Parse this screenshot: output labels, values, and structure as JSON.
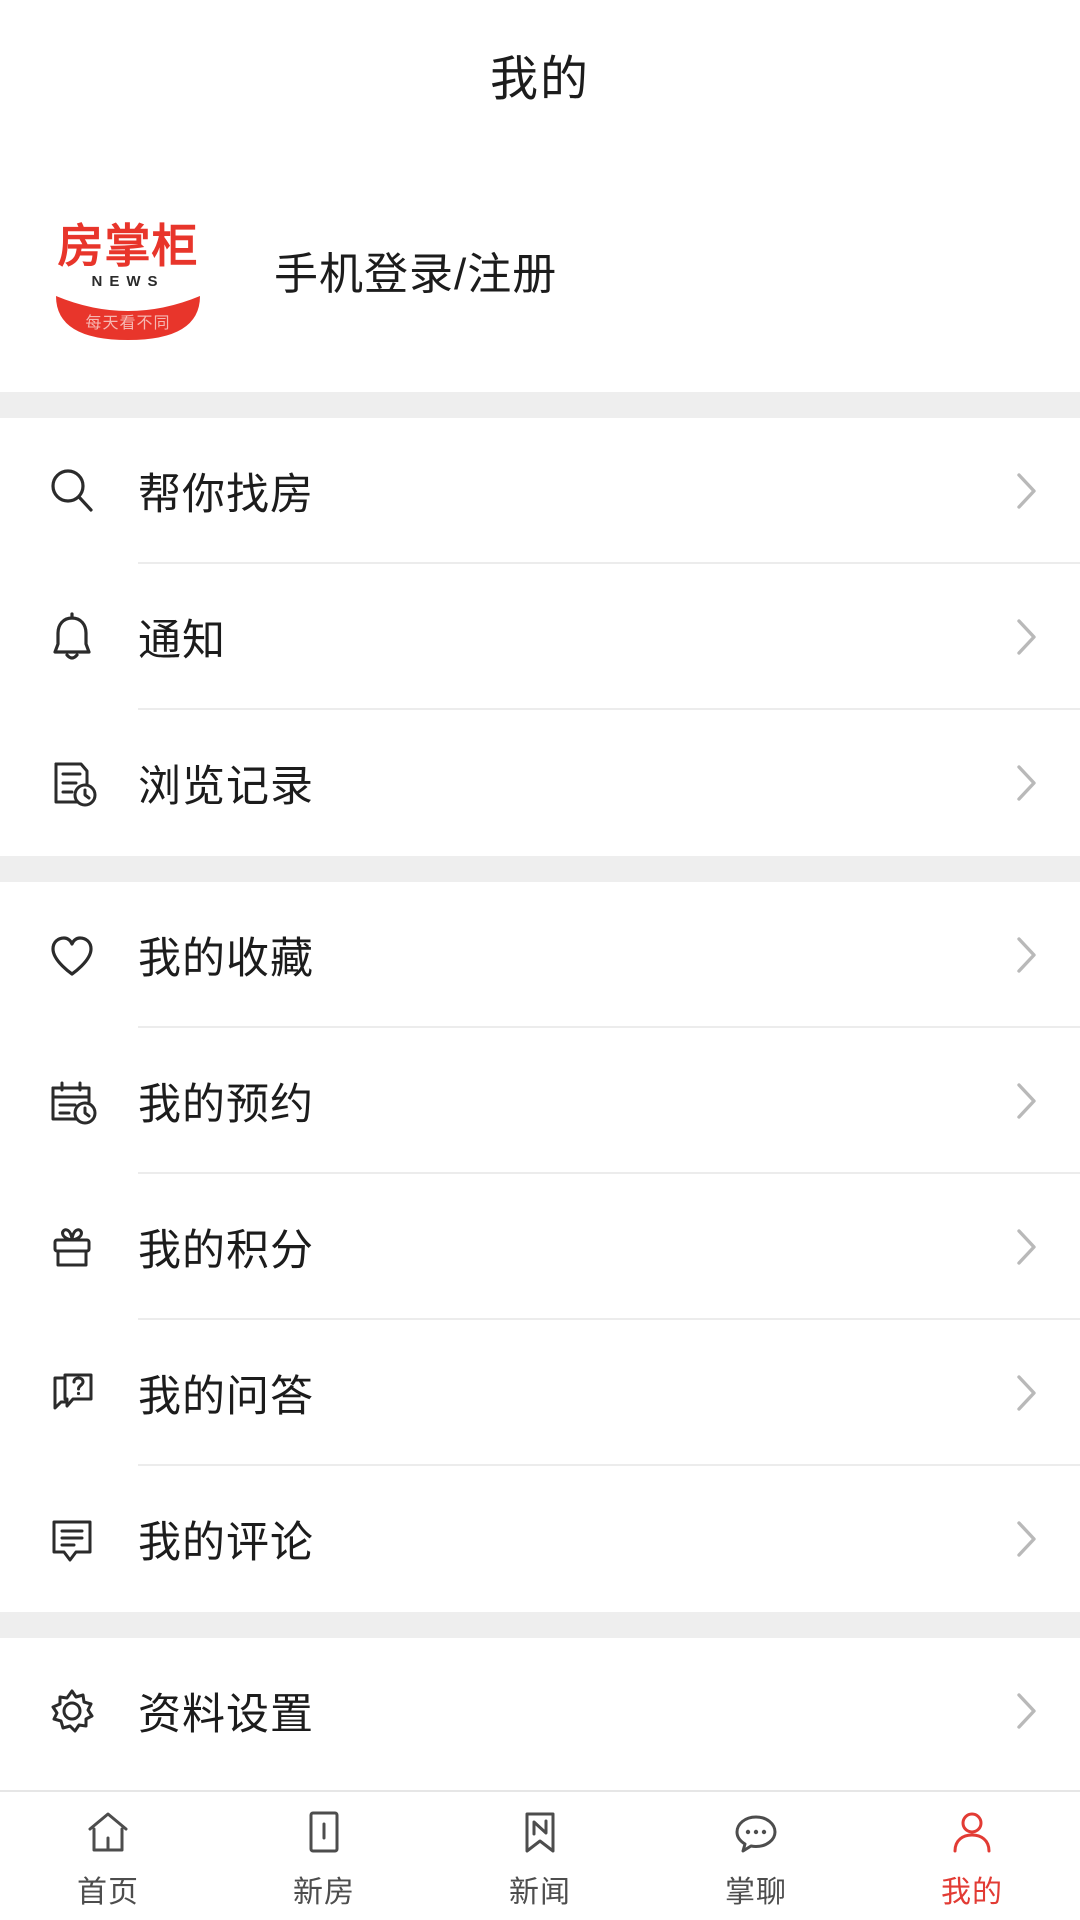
{
  "header": {
    "title": "我的"
  },
  "profile": {
    "logo": {
      "name": "fangzhanggui-news-logo",
      "brand_text": "房掌柜",
      "sub_text": "N E W S",
      "tagline": "每天看不同",
      "color": "#e8352b"
    },
    "login_label": "手机登录/注册"
  },
  "menu_groups": [
    {
      "items": [
        {
          "icon": "search-icon",
          "label": "帮你找房"
        },
        {
          "icon": "bell-icon",
          "label": "通知"
        },
        {
          "icon": "history-document-clock-icon",
          "label": "浏览记录"
        }
      ]
    },
    {
      "items": [
        {
          "icon": "heart-icon",
          "label": "我的收藏"
        },
        {
          "icon": "calendar-clock-icon",
          "label": "我的预约"
        },
        {
          "icon": "gift-icon",
          "label": "我的积分"
        },
        {
          "icon": "question-bubbles-icon",
          "label": "我的问答"
        },
        {
          "icon": "comment-bubble-icon",
          "label": "我的评论"
        }
      ]
    },
    {
      "items": [
        {
          "icon": "gear-icon",
          "label": "资料设置"
        }
      ]
    }
  ],
  "chevron_icon": "chevron-right-icon",
  "tabbar": {
    "active_color": "#e23b34",
    "inactive_color": "#4d4d4d",
    "tabs": [
      {
        "icon": "home-icon",
        "label": "首页",
        "active": false
      },
      {
        "icon": "new-house-icon",
        "label": "新房",
        "active": false
      },
      {
        "icon": "news-icon",
        "label": "新闻",
        "active": false
      },
      {
        "icon": "chat-icon",
        "label": "掌聊",
        "active": false
      },
      {
        "icon": "user-icon",
        "label": "我的",
        "active": true
      }
    ]
  }
}
